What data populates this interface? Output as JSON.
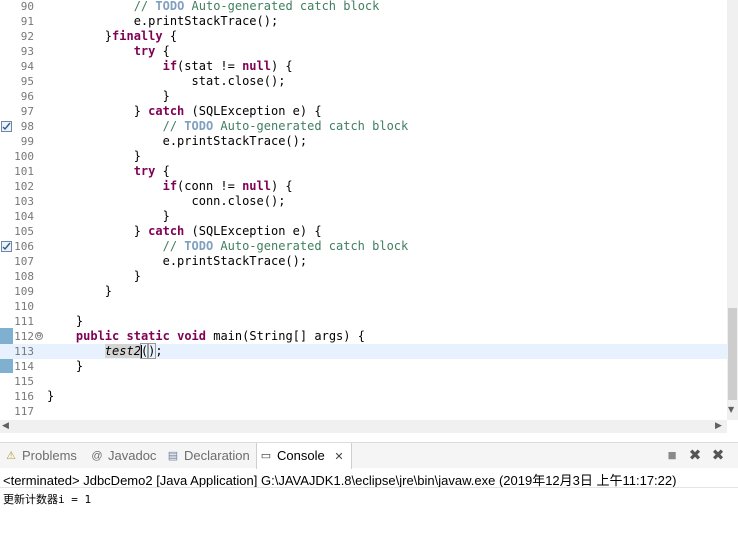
{
  "editor": {
    "lines": [
      {
        "num": "90",
        "marker": false,
        "fold": "",
        "segs": [
          [
            "",
            "            "
          ],
          [
            "cm",
            "// "
          ],
          [
            "todo",
            "TODO"
          ],
          [
            "cm",
            " Auto-generated catch block"
          ]
        ]
      },
      {
        "num": "91",
        "marker": false,
        "fold": "",
        "segs": [
          [
            "",
            "            e.printStackTrace();"
          ]
        ]
      },
      {
        "num": "92",
        "marker": false,
        "fold": "",
        "segs": [
          [
            "",
            "        }"
          ],
          [
            "kw",
            "finally"
          ],
          [
            "",
            " {"
          ]
        ]
      },
      {
        "num": "93",
        "marker": false,
        "fold": "",
        "segs": [
          [
            "",
            "            "
          ],
          [
            "kw",
            "try"
          ],
          [
            "",
            " {"
          ]
        ]
      },
      {
        "num": "94",
        "marker": false,
        "fold": "",
        "segs": [
          [
            "",
            "                "
          ],
          [
            "kw",
            "if"
          ],
          [
            "",
            "(stat != "
          ],
          [
            "kw",
            "null"
          ],
          [
            "",
            ") {"
          ]
        ]
      },
      {
        "num": "95",
        "marker": false,
        "fold": "",
        "segs": [
          [
            "",
            "                    stat.close();"
          ]
        ]
      },
      {
        "num": "96",
        "marker": false,
        "fold": "",
        "segs": [
          [
            "",
            "                }"
          ]
        ]
      },
      {
        "num": "97",
        "marker": false,
        "fold": "",
        "segs": [
          [
            "",
            "            } "
          ],
          [
            "kw",
            "catch"
          ],
          [
            "",
            " (SQLException e) {"
          ]
        ]
      },
      {
        "num": "98",
        "marker": true,
        "fold": "",
        "segs": [
          [
            "",
            "                "
          ],
          [
            "cm",
            "// "
          ],
          [
            "todo",
            "TODO"
          ],
          [
            "cm",
            " Auto-generated catch block"
          ]
        ]
      },
      {
        "num": "99",
        "marker": false,
        "fold": "",
        "segs": [
          [
            "",
            "                e.printStackTrace();"
          ]
        ]
      },
      {
        "num": "100",
        "marker": false,
        "fold": "",
        "segs": [
          [
            "",
            "            }"
          ]
        ]
      },
      {
        "num": "101",
        "marker": false,
        "fold": "",
        "segs": [
          [
            "",
            "            "
          ],
          [
            "kw",
            "try"
          ],
          [
            "",
            " {"
          ]
        ]
      },
      {
        "num": "102",
        "marker": false,
        "fold": "",
        "segs": [
          [
            "",
            "                "
          ],
          [
            "kw",
            "if"
          ],
          [
            "",
            "(conn != "
          ],
          [
            "kw",
            "null"
          ],
          [
            "",
            ") {"
          ]
        ]
      },
      {
        "num": "103",
        "marker": false,
        "fold": "",
        "segs": [
          [
            "",
            "                    conn.close();"
          ]
        ]
      },
      {
        "num": "104",
        "marker": false,
        "fold": "",
        "segs": [
          [
            "",
            "                }"
          ]
        ]
      },
      {
        "num": "105",
        "marker": false,
        "fold": "",
        "segs": [
          [
            "",
            "            } "
          ],
          [
            "kw",
            "catch"
          ],
          [
            "",
            " (SQLException e) {"
          ]
        ]
      },
      {
        "num": "106",
        "marker": true,
        "fold": "",
        "segs": [
          [
            "",
            "                "
          ],
          [
            "cm",
            "// "
          ],
          [
            "todo",
            "TODO"
          ],
          [
            "cm",
            " Auto-generated catch block"
          ]
        ]
      },
      {
        "num": "107",
        "marker": false,
        "fold": "",
        "segs": [
          [
            "",
            "                e.printStackTrace();"
          ]
        ]
      },
      {
        "num": "108",
        "marker": false,
        "fold": "",
        "segs": [
          [
            "",
            "            }"
          ]
        ]
      },
      {
        "num": "109",
        "marker": false,
        "fold": "",
        "segs": [
          [
            "",
            "        }"
          ]
        ]
      },
      {
        "num": "110",
        "marker": false,
        "fold": "",
        "segs": [
          [
            "",
            ""
          ]
        ]
      },
      {
        "num": "111",
        "marker": false,
        "fold": "",
        "segs": [
          [
            "",
            "    }"
          ]
        ]
      },
      {
        "num": "112",
        "marker": false,
        "fold": "⊖",
        "segs": [
          [
            "",
            "    "
          ],
          [
            "kw",
            "public"
          ],
          [
            "",
            " "
          ],
          [
            "kw",
            "static"
          ],
          [
            "",
            " "
          ],
          [
            "kw",
            "void"
          ],
          [
            "",
            " main(String[] args) {"
          ]
        ]
      },
      {
        "num": "113",
        "marker": false,
        "fold": "",
        "current": true,
        "segs": [
          [
            "",
            "        "
          ],
          [
            "mi",
            "test2"
          ],
          [
            "caret",
            ""
          ],
          [
            "br",
            "("
          ],
          [
            "br",
            ")"
          ],
          [
            "",
            ";"
          ]
        ]
      },
      {
        "num": "114",
        "marker": false,
        "fold": "",
        "segs": [
          [
            "",
            "    }"
          ]
        ]
      },
      {
        "num": "115",
        "marker": false,
        "fold": "",
        "segs": [
          [
            "",
            ""
          ]
        ]
      },
      {
        "num": "116",
        "marker": false,
        "fold": "",
        "segs": [
          [
            "",
            "}"
          ]
        ]
      },
      {
        "num": "117",
        "marker": false,
        "fold": "",
        "segs": [
          [
            "",
            ""
          ]
        ]
      }
    ]
  },
  "bottom_panel": {
    "tabs": [
      {
        "label": "Problems",
        "icon": "problems-icon",
        "glyph": "⚠",
        "active": false
      },
      {
        "label": "Javadoc",
        "icon": "javadoc-icon",
        "glyph": "@",
        "active": false
      },
      {
        "label": "Declaration",
        "icon": "declaration-icon",
        "glyph": "▤",
        "active": false
      },
      {
        "label": "Console",
        "icon": "console-icon",
        "glyph": "▭",
        "active": true,
        "close": "✕"
      }
    ],
    "toolbar": {
      "terminate_glyph": "■",
      "remove_glyph": "✖",
      "remove_all_glyph": "✖"
    }
  },
  "console": {
    "header": "<terminated> JdbcDemo2 [Java Application] G:\\JAVAJDK1.8\\eclipse\\jre\\bin\\javaw.exe (2019年12月3日 上午11:17:22)",
    "output": "更新计数器i = 1"
  },
  "colors": {
    "keyword": "#7f0055",
    "comment": "#3f7f5f",
    "todo": "#7f9fbf",
    "current_line": "#e8f2fe",
    "change_bar": "#7fb0cf"
  }
}
